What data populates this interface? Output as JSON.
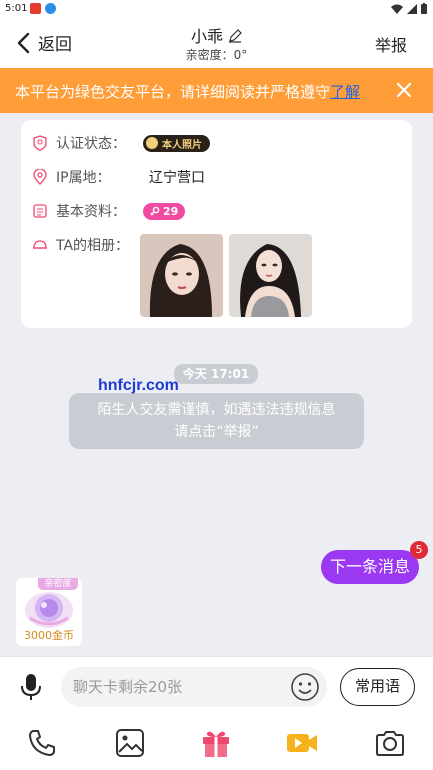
{
  "status_bar": {
    "time": "5:01"
  },
  "nav": {
    "back_label": "返回",
    "title": "小乖",
    "subtitle": "亲密度：0°",
    "report_label": "举报"
  },
  "banner": {
    "text": "本平台为绿色交友平台，请详细阅读并严格遵守",
    "link_text": "了解"
  },
  "profile": {
    "verify_label": "认证状态：",
    "verify_badge": "本人照片",
    "ip_label": "IP属地：",
    "ip_value": "辽宁营口",
    "info_label": "基本资料：",
    "age": "29",
    "album_label": "TA的相册："
  },
  "chat": {
    "timestamp": "今天 17:01",
    "system_line1": "陌生人交友需谨慎，如遇违法违规信息",
    "system_line2": "请点击“举报”",
    "watermark": "hnfcjr.com"
  },
  "next_message": {
    "label": "下一条消息",
    "count": "5"
  },
  "intimacy_widget": {
    "tag": "亲密度",
    "coins": "3000金币"
  },
  "input_bar": {
    "placeholder": "聊天卡剩余20张",
    "phrases_label": "常用语"
  },
  "colors": {
    "banner_bg": "#ff9d39",
    "link": "#1e63e9",
    "accent_purple": "#9a38f2",
    "badge_pink": "#f04aa3",
    "gift_pink": "#f0476f",
    "video_yellow": "#f6b21b"
  },
  "icons": [
    "back-icon",
    "edit-icon",
    "close-icon",
    "shield-icon",
    "location-icon",
    "profile-icon",
    "album-icon",
    "mic-icon",
    "emoji-icon",
    "phone-icon",
    "image-icon",
    "gift-icon",
    "video-icon",
    "camera-icon"
  ]
}
